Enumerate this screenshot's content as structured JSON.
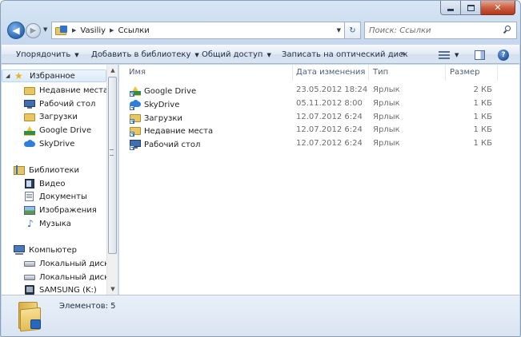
{
  "address": {
    "crumbs": [
      "Vasiliy",
      "Ссылки"
    ]
  },
  "search": {
    "placeholder": "Поиск: Ссылки"
  },
  "toolbar": {
    "organize": "Упорядочить",
    "add_library": "Добавить в библиотеку",
    "share": "Общий доступ",
    "burn": "Записать на оптический диск",
    "more": "»"
  },
  "nav": {
    "favorites": {
      "label": "Избранное",
      "items": [
        "Недавние места",
        "Рабочий стол",
        "Загрузки",
        "Google Drive",
        "SkyDrive"
      ]
    },
    "libraries": {
      "label": "Библиотеки",
      "items": [
        "Видео",
        "Документы",
        "Изображения",
        "Музыка"
      ]
    },
    "computer": {
      "label": "Компьютер",
      "items": [
        "Локальный диск (C",
        "Локальный диск (D",
        "SAMSUNG (K:)"
      ]
    }
  },
  "columns": {
    "name": "Имя",
    "date": "Дата изменения",
    "type": "Тип",
    "size": "Размер"
  },
  "files": [
    {
      "name": "Google Drive",
      "date": "23.05.2012 18:24",
      "type": "Ярлык",
      "size": "2 КБ",
      "icon": "google-drive-icon"
    },
    {
      "name": "SkyDrive",
      "date": "05.11.2012 8:00",
      "type": "Ярлык",
      "size": "1 КБ",
      "icon": "skydrive-icon"
    },
    {
      "name": "Загрузки",
      "date": "12.07.2012 6:24",
      "type": "Ярлык",
      "size": "1 КБ",
      "icon": "downloads-icon"
    },
    {
      "name": "Недавние места",
      "date": "12.07.2012 6:24",
      "type": "Ярлык",
      "size": "1 КБ",
      "icon": "recent-places-icon"
    },
    {
      "name": "Рабочий стол",
      "date": "12.07.2012 6:24",
      "type": "Ярлык",
      "size": "1 КБ",
      "icon": "desktop-icon"
    }
  ],
  "status": {
    "items_label": "Элементов: 5"
  }
}
